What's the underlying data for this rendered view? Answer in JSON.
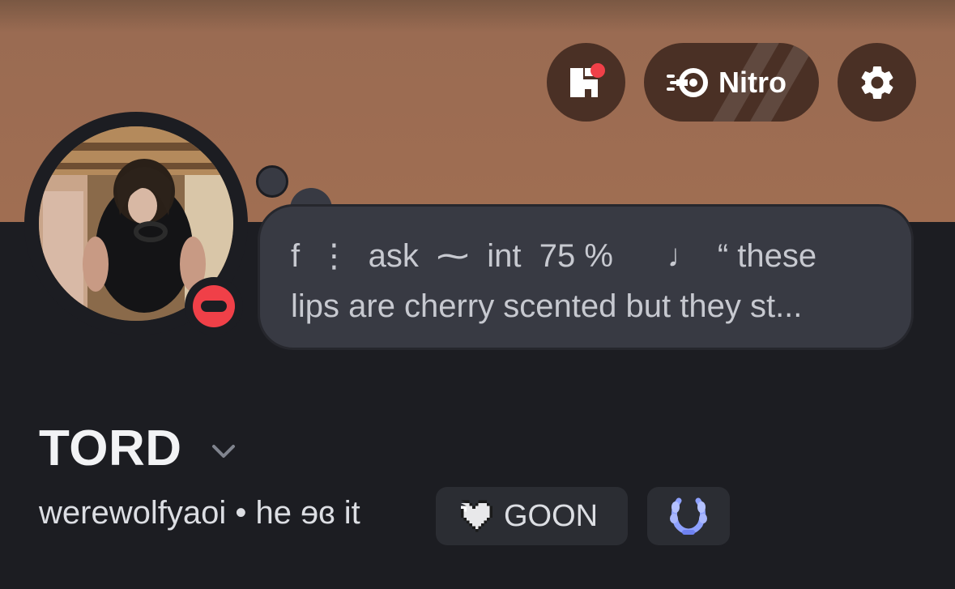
{
  "header": {
    "shop_icon": "shop-icon",
    "shop_notification": true,
    "nitro_label": "Nitro",
    "nitro_icon": "nitro-icon",
    "settings_icon": "gear-icon"
  },
  "profile": {
    "avatar": "user-avatar-photo",
    "status": "do-not-disturb",
    "custom_status_line1": "f  ⋮  ask  ⁓  int  75 %      ♩  “ these",
    "custom_status_line2": "lips are cherry scented but they st...",
    "display_name": "TORD",
    "username": "werewolfyaoi",
    "separator": " • ",
    "pronouns": "he ɘɞ it",
    "tag_label": "GOON",
    "tag_icon": "pixel-heart-icon",
    "badge_icon": "laurel-badge-icon"
  },
  "colors": {
    "banner": "#a06e52",
    "background": "#1c1d22",
    "bubble": "#383a43",
    "dnd": "#f04048",
    "button": "#4a3025",
    "badge": "#8ea1ff"
  }
}
